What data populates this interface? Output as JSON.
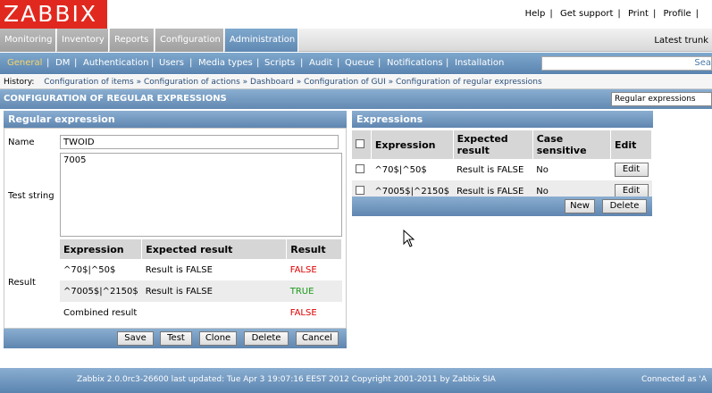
{
  "logo": "ZABBIX",
  "top_links": [
    "Help",
    "Get support",
    "Print",
    "Profile"
  ],
  "main_menu": [
    "Monitoring",
    "Inventory",
    "Reports",
    "Configuration",
    "Administration"
  ],
  "latest": "Latest trunk",
  "sub_menu": [
    "General",
    "DM",
    "Authentication",
    "Users",
    "Media types",
    "Scripts",
    "Audit",
    "Queue",
    "Notifications",
    "Installation"
  ],
  "search": {
    "placeholder": "",
    "button": "Sea"
  },
  "history": {
    "label": "History:",
    "items": [
      "Configuration of items",
      "Configuration of actions",
      "Dashboard",
      "Configuration of GUI",
      "Configuration of regular expressions"
    ]
  },
  "page_title": "CONFIGURATION OF REGULAR EXPRESSIONS",
  "view_select": "Regular expressions",
  "form": {
    "title": "Regular expression",
    "name_label": "Name",
    "name_value": "TWOID",
    "test_label": "Test string",
    "test_value": "7005",
    "result_label": "Result",
    "result_headers": [
      "Expression",
      "Expected result",
      "Result"
    ],
    "result_rows": [
      {
        "expr": "^70$|^50$",
        "expected": "Result is FALSE",
        "result": "FALSE"
      },
      {
        "expr": "^7005$|^2150$",
        "expected": "Result is FALSE",
        "result": "TRUE"
      },
      {
        "expr": "Combined result",
        "expected": "",
        "result": "FALSE"
      }
    ],
    "buttons": [
      "Save",
      "Test",
      "Clone",
      "Delete",
      "Cancel"
    ]
  },
  "expressions": {
    "title": "Expressions",
    "headers": [
      "Expression",
      "Expected result",
      "Case sensitive",
      "Edit"
    ],
    "rows": [
      {
        "expr": "^70$|^50$",
        "expected": "Result is FALSE",
        "case": "No",
        "edit": "Edit"
      },
      {
        "expr": "^7005$|^2150$",
        "expected": "Result is FALSE",
        "case": "No",
        "edit": "Edit"
      }
    ],
    "buttons": [
      "New",
      "Delete"
    ]
  },
  "footer": {
    "copyright": "Zabbix 2.0.0rc3-26600 last updated: Tue Apr 3 19:07:16 EEST 2012 Copyright 2001-2011 by Zabbix SIA",
    "connected": "Connected as 'A"
  }
}
